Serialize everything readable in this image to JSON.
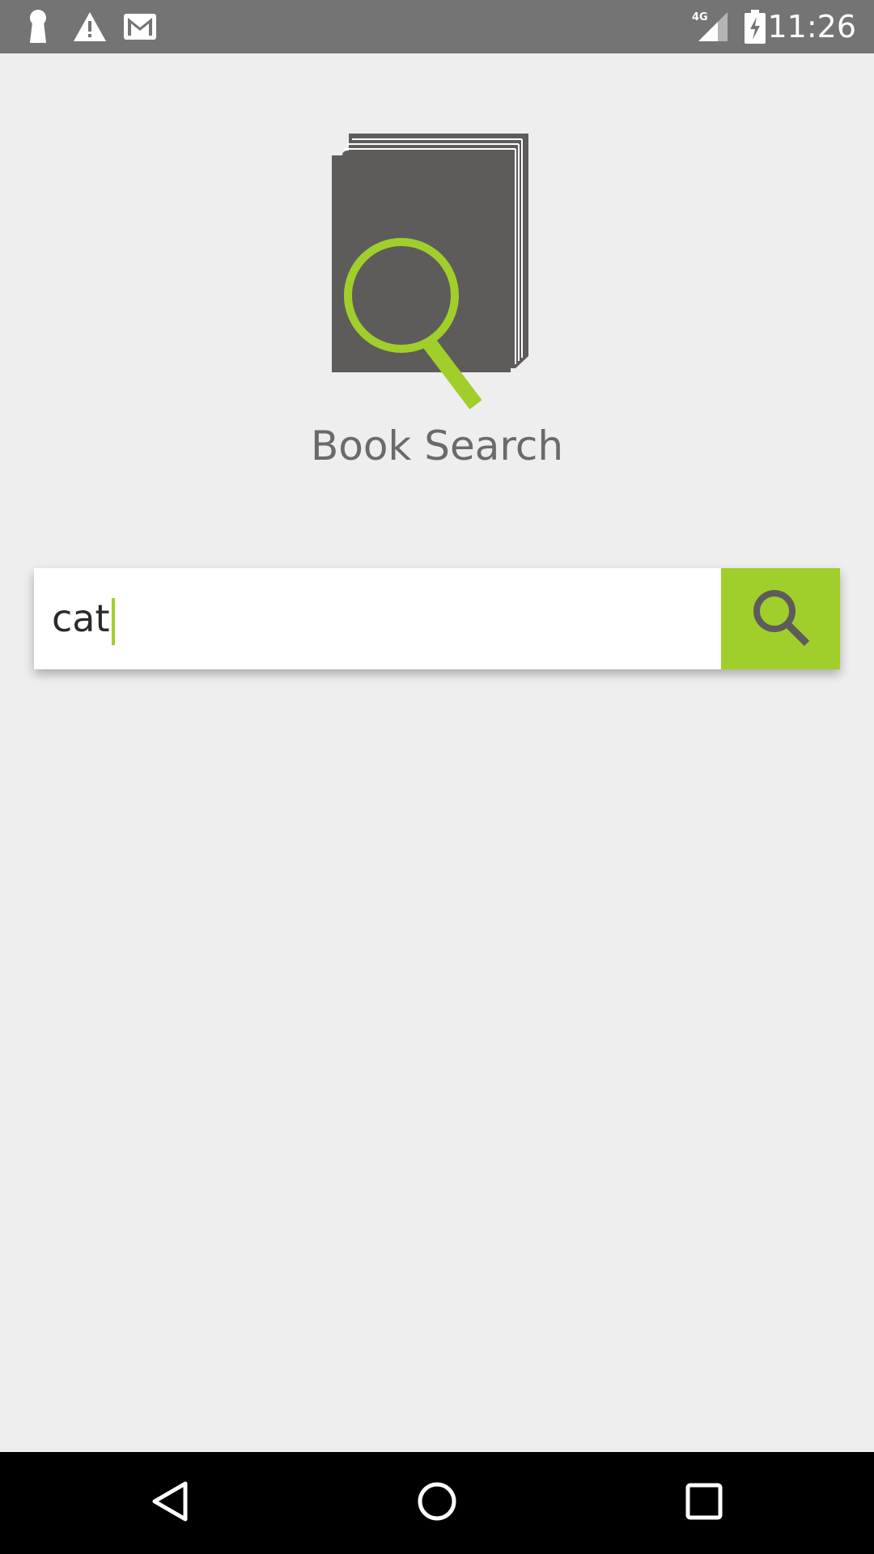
{
  "status_bar": {
    "time": "11:26",
    "network": "4G",
    "icons": [
      "keyhole-icon",
      "warning-icon",
      "gmail-icon",
      "signal-icon",
      "battery-charging-icon"
    ]
  },
  "app": {
    "title": "Book Search",
    "logo_icon": "book-search-logo"
  },
  "search": {
    "value": "cat",
    "button_icon": "search-icon"
  },
  "nav_bar": {
    "buttons": [
      "back-icon",
      "home-icon",
      "recents-icon"
    ]
  },
  "colors": {
    "accent": "#a0cf2b",
    "status_bar": "#747474",
    "background": "#eeeeee",
    "book": "#5e5b5b",
    "title_text": "#6a6a6a"
  }
}
